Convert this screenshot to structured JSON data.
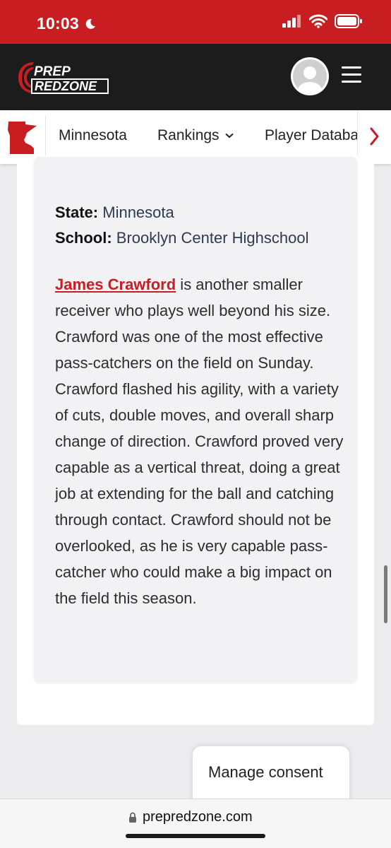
{
  "status_bar": {
    "time": "10:03",
    "background": "#c81e22"
  },
  "header": {
    "logo_line1": "PREP",
    "logo_line2": "REDZONE"
  },
  "nav": {
    "items": [
      "Minnesota",
      "Rankings",
      "Player Database"
    ],
    "state_icon": "minnesota-state-icon",
    "accent": "#c81e22"
  },
  "profile": {
    "state_label": "State:",
    "state_value": "Minnesota",
    "school_label": "School:",
    "school_value": "Brooklyn Center Highschool"
  },
  "article": {
    "player_link": "James Crawford",
    "body": " is another smaller receiver who plays well beyond his size. Crawford was one of the most effective pass-catchers on the field on Sunday. Crawford flashed his agility, with a variety of cuts, double moves, and overall sharp change of direction. Crawford proved very capable as a vertical threat, doing a great job at extending for the ball and catching through contact. Crawford should not be overlooked, as he is very capable pass-catcher who could make a big impact on the field this season."
  },
  "consent": {
    "label": "Manage consent"
  },
  "browser": {
    "url": "prepredzone.com"
  }
}
